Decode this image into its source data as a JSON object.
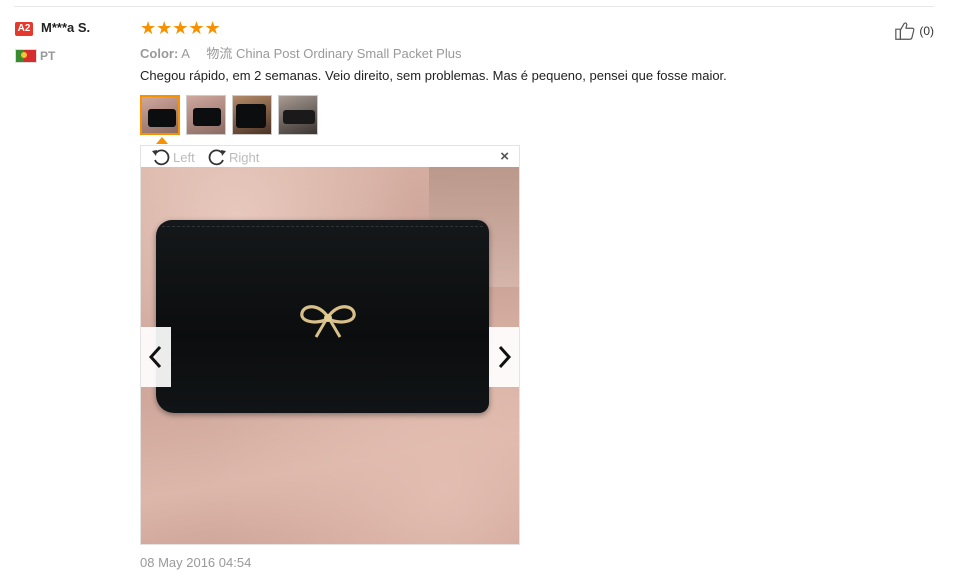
{
  "review": {
    "user_badge": "A2",
    "user_name": "M***a S.",
    "country_code": "PT",
    "rating_stars": "★★★★★",
    "rating": 5,
    "color_label": "Color:",
    "color_value": "A",
    "shipping_prefix": "物流",
    "shipping_method": "China Post Ordinary Small Packet Plus",
    "text": "Chegou rápido, em 2 semanas. Veio direito, sem problemas. Mas é pequeno, pensei que fosse maior.",
    "like_count": "(0)",
    "date": "08 May 2016 04:54"
  },
  "viewer": {
    "rotate_left_label": "Left",
    "rotate_right_label": "Right",
    "close_symbol": "×"
  },
  "colors": {
    "accent": "#f79100",
    "badge": "#e4392c",
    "muted_text": "#999999"
  },
  "icons": [
    "thumb-up-icon",
    "rotate-left-icon",
    "rotate-right-icon",
    "close-icon",
    "chevron-left-icon",
    "chevron-right-icon",
    "portugal-flag-icon",
    "star-icon"
  ]
}
